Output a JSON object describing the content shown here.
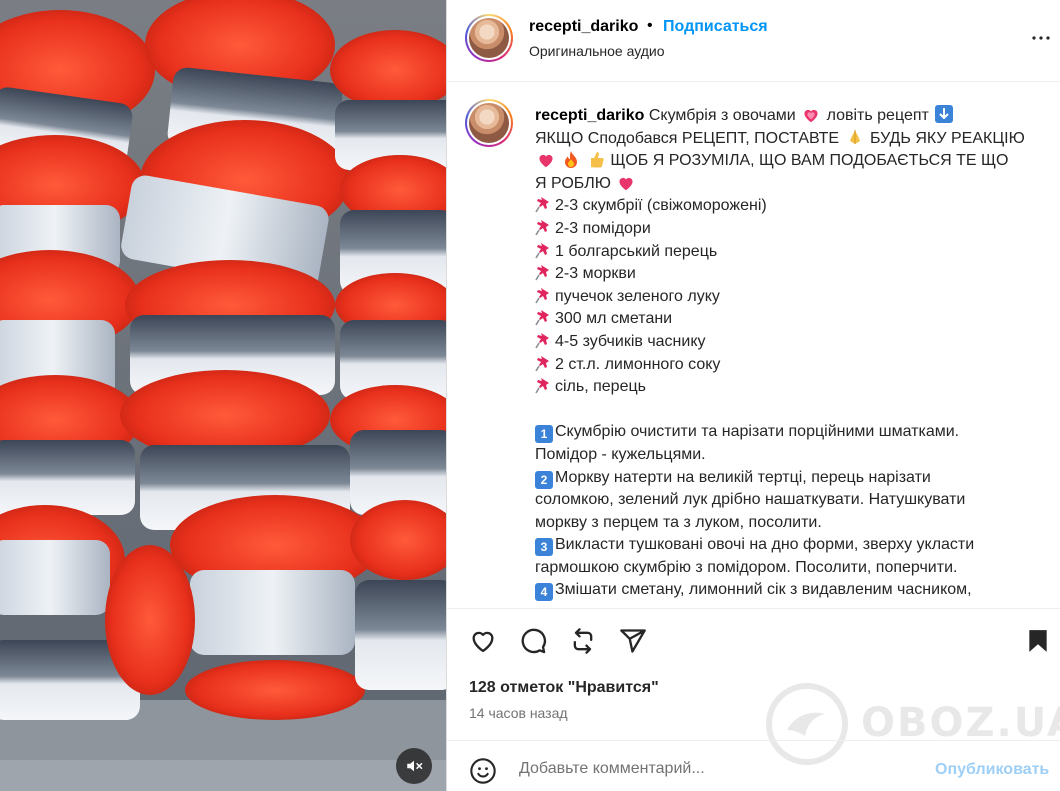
{
  "header": {
    "username": "recepti_dariko",
    "separator": "•",
    "follow_label": "Подписаться",
    "audio_label": "Оригинальное аудио"
  },
  "caption": {
    "username": "recepti_dariko",
    "line1": "Скумбрія з овочами",
    "line1b": "ловіть рецепт",
    "line2a": "ЯКЩО Сподобався РЕЦЕПТ, ПОСТАВТЕ",
    "line2b": "БУДЬ ЯКУ РЕАКЦІЮ",
    "line3": "ЩОБ Я РОЗУМІЛА, ЩО ВАМ ПОДОБАЄТЬСЯ ТЕ ЩО",
    "line4": "Я РОБЛЮ",
    "ingredients": [
      "2-3 скумбрії (свіжоморожені)",
      "2-3 помідори",
      "1 болгарський перець",
      "2-3 моркви",
      "пучечок зеленого луку",
      "300 мл сметани",
      "4-5 зубчиків часнику",
      "2 ст.л. лимонного соку",
      "сіль, перець"
    ],
    "steps": [
      {
        "num": "1",
        "lines": [
          "Скумбрію очистити та нарізати порційними шматками.",
          "Помідор - кужельцями."
        ]
      },
      {
        "num": "2",
        "lines": [
          "Моркву натерти на великій тертці, перець нарізати",
          "соломкою, зелений лук дрібно нашаткувати. Натушкувати",
          "моркву з перцем та з луком, посолити."
        ]
      },
      {
        "num": "3",
        "lines": [
          "Викласти тушковані овочі на дно форми, зверху укласти",
          "гармошкою скумбрію з помідором. Посолити, поперчити."
        ]
      },
      {
        "num": "4",
        "lines": [
          "Змішати сметану, лимонний сік з видавленим часником,"
        ]
      }
    ]
  },
  "actions": {
    "likes": "128 отметок \"Нравится\"",
    "time": "14 часов назад"
  },
  "comment": {
    "placeholder": "Добавьте комментарий...",
    "post_label": "Опубликовать"
  },
  "watermark": {
    "text": "OBOZ.UA"
  },
  "colors": {
    "accent": "#0095f6",
    "post_disabled": "#9ecff7"
  },
  "icons": [
    "more-icon",
    "heart-icon",
    "comment-icon",
    "repost-icon",
    "share-icon",
    "bookmark-icon",
    "emoji-icon",
    "mute-icon",
    "pin-icon"
  ]
}
